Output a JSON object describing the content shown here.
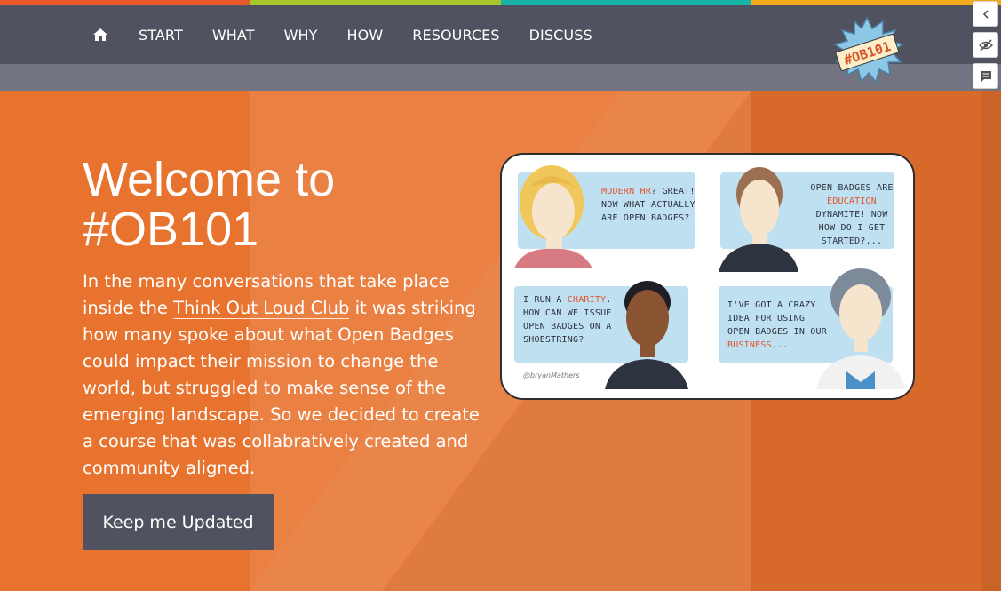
{
  "colors": {
    "stripe": [
      "#e85a2b",
      "#a6c72c",
      "#17b3a6",
      "#f6aa20"
    ],
    "nav_bg": "#50535f",
    "subbar_bg": "#727482",
    "hero_bg": "#e8732e",
    "button_bg": "#50535f",
    "accent": "#e2552a"
  },
  "nav": {
    "home_icon": "home-icon",
    "items": [
      "START",
      "WHAT",
      "WHY",
      "HOW",
      "RESOURCES",
      "DISCUSS"
    ]
  },
  "logo": {
    "text": "#OB101"
  },
  "side_tools": {
    "collapse_icon": "chevron-left-icon",
    "hide_icon": "eye-slash-icon",
    "comment_icon": "comment-icon"
  },
  "hero": {
    "title": "Welcome to #OB101",
    "intro_before": "In the many conversations that take place inside the ",
    "intro_link": "Think Out Loud Club",
    "intro_after": " it was striking how many spoke about what Open Badges could impact their mission to change the world, but struggled to make sense of the emerging landscape. So we decided to create a course that was collabratively created and community aligned.",
    "button": "Keep me Updated"
  },
  "comic": {
    "panel1": {
      "hl": "MODERN HR",
      "text": "? GREAT! NOW WHAT ACTUALLY ARE OPEN BADGES?"
    },
    "panel2": {
      "pre": "OPEN BADGES ARE ",
      "hl": "EDUCATION",
      "text": " DYNAMITE! NOW HOW DO I GET STARTED?..."
    },
    "panel3": {
      "pre": "I RUN A ",
      "hl": "CHARITY",
      "text": ". HOW CAN WE ISSUE OPEN BADGES ON A SHOESTRING?"
    },
    "panel4": {
      "pre": "I'VE GOT A CRAZY IDEA FOR USING OPEN BADGES IN OUR ",
      "hl": "BUSINESS",
      "text": "..."
    },
    "credit": "@bryanMathers"
  }
}
